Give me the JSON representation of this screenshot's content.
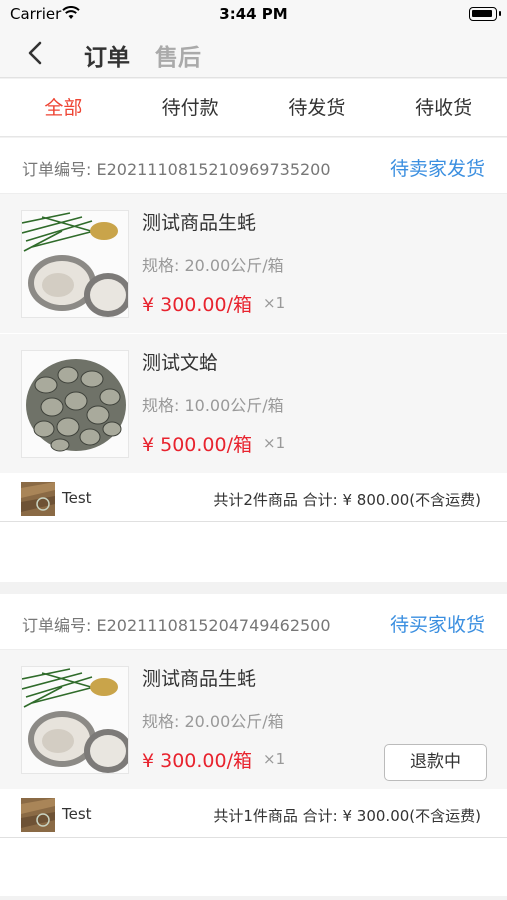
{
  "status_bar": {
    "carrier": "Carrier",
    "time": "3:44 PM",
    "wifi_icon": "wifi-icon",
    "battery_icon": "battery-icon"
  },
  "nav": {
    "back_icon": "chevron-left-icon",
    "title": "订单",
    "title_secondary": "售后"
  },
  "tabs": [
    {
      "label": "全部",
      "active": true
    },
    {
      "label": "待付款",
      "active": false
    },
    {
      "label": "待发货",
      "active": false
    },
    {
      "label": "待收货",
      "active": false
    }
  ],
  "colors": {
    "accent_red": "#ee4433",
    "price_red": "#e8232e",
    "status_blue": "#3b8fe0"
  },
  "orders": [
    {
      "order_no": "订单编号: E2021110815210969735200",
      "status": "待卖家发货",
      "items": [
        {
          "image": "oyster-photo",
          "name": "测试商品生蚝",
          "spec": "规格: 20.00公斤/箱",
          "price": "¥ 300.00/箱",
          "qty": "×1"
        },
        {
          "image": "clam-photo",
          "name": "测试文蛤",
          "spec": "规格: 10.00公斤/箱",
          "price": "¥ 500.00/箱",
          "qty": "×1"
        }
      ],
      "shop_name": "Test",
      "summary": "共计2件商品    合计: ¥ 800.00(不含运费)"
    },
    {
      "order_no": "订单编号: E2021110815204749462500",
      "status": "待买家收货",
      "items": [
        {
          "image": "oyster-photo",
          "name": "测试商品生蚝",
          "spec": "规格: 20.00公斤/箱",
          "price": "¥ 300.00/箱",
          "qty": "×1",
          "action": "退款中"
        }
      ],
      "shop_name": "Test",
      "summary": "共计1件商品    合计: ¥ 300.00(不含运费)"
    }
  ]
}
